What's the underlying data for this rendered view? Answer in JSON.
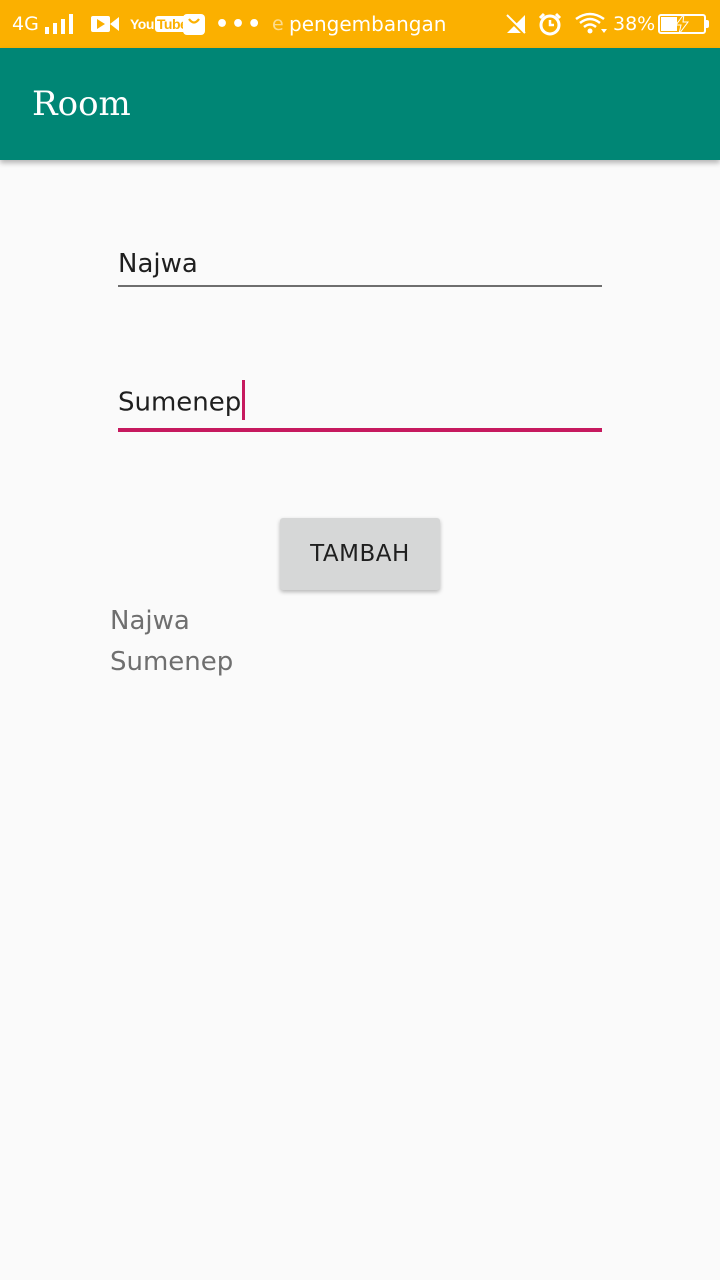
{
  "status_bar": {
    "network": "4G",
    "youtube_label": "You",
    "youtube_tube": "Tube",
    "more": "•••",
    "notification_prefix": "e",
    "notification_text": "pengembangan",
    "battery_percent": "38%",
    "battery_level": 0.38,
    "icons": [
      "signal-icon",
      "video-icon",
      "youtube-icon",
      "shopping-bag-icon",
      "more-icon",
      "vibrate-off-icon",
      "alarm-icon",
      "wifi-icon",
      "battery-charging-icon"
    ],
    "background_color": "#fbb000"
  },
  "toolbar": {
    "title": "Room",
    "background_color": "#008675"
  },
  "form": {
    "name_value": "Najwa",
    "address_value": "Sumenep",
    "accent_color": "#c6195e"
  },
  "button": {
    "label": "TAMBAH"
  },
  "results": [
    "Najwa",
    "Sumenep"
  ]
}
